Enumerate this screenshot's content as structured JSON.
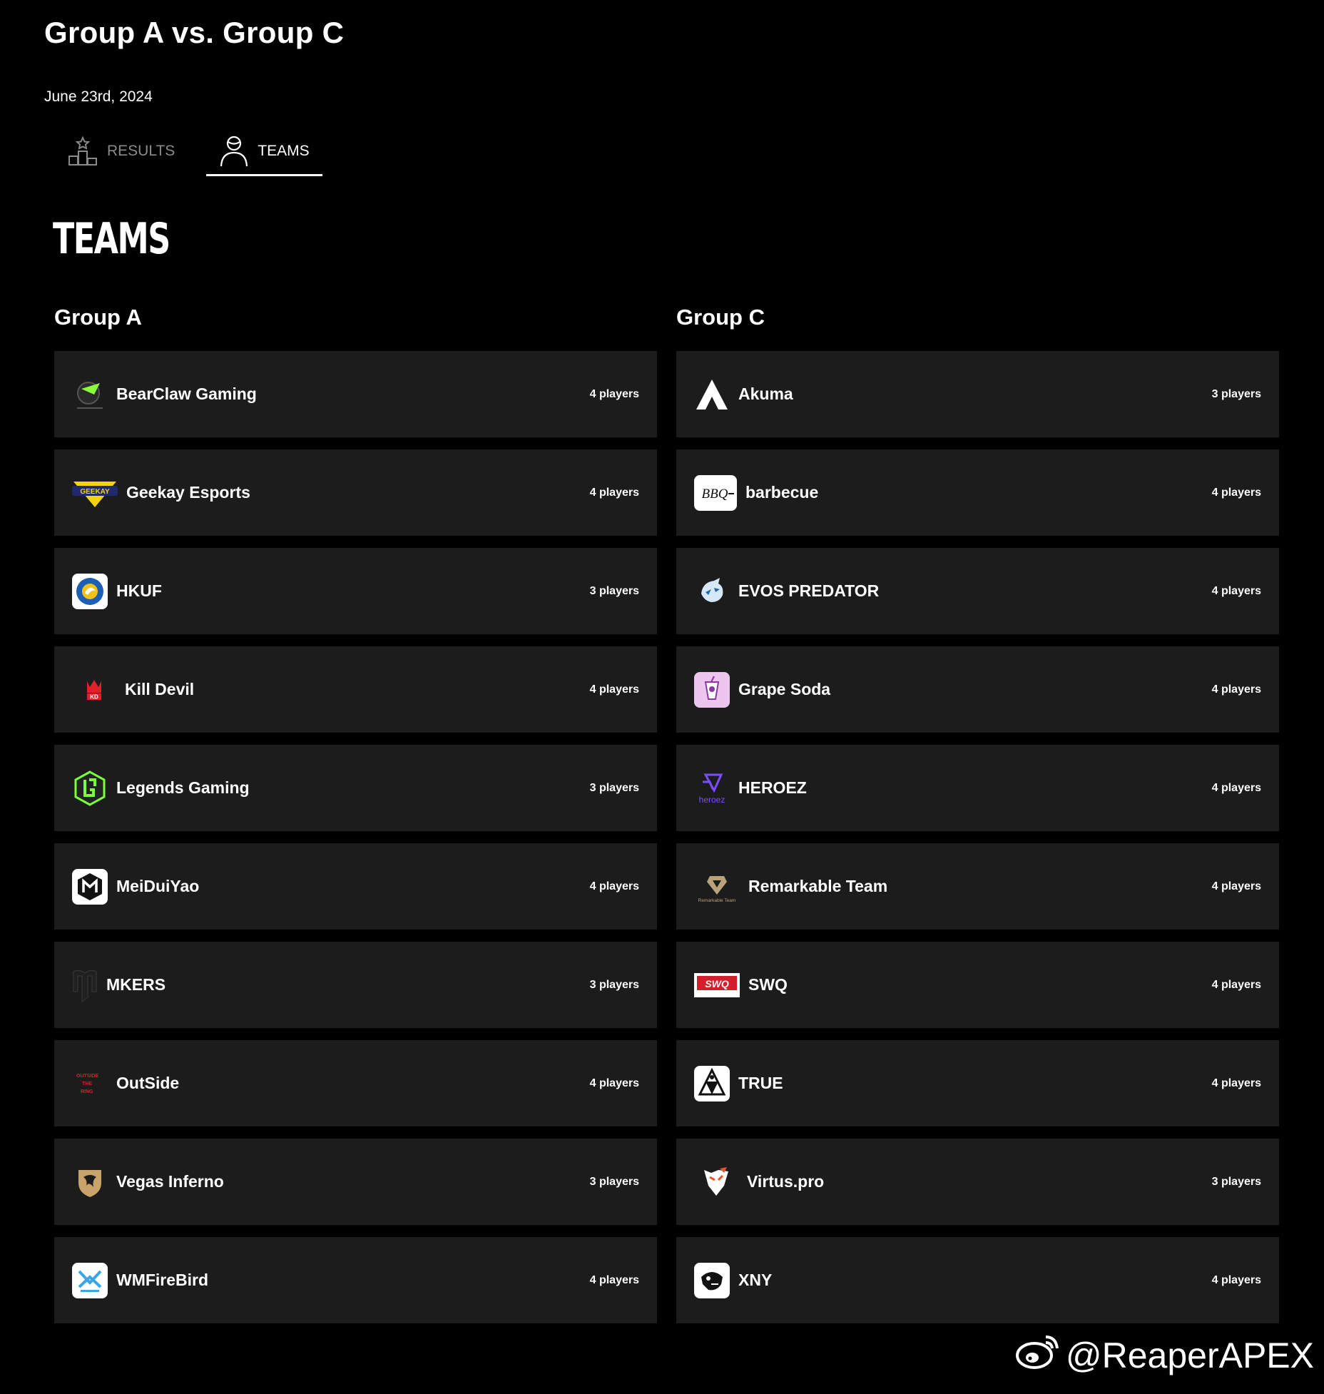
{
  "page": {
    "title": "Group A vs. Group C",
    "date": "June 23rd, 2024"
  },
  "tabs": [
    {
      "label": "RESULTS",
      "icon": "podium-icon"
    },
    {
      "label": "TEAMS",
      "icon": "person-icon"
    }
  ],
  "section_heading": "TEAMS",
  "groups": [
    {
      "title": "Group A",
      "teams": [
        {
          "name": "BearClaw Gaming",
          "players": "4 players",
          "logo": "bearclaw-logo"
        },
        {
          "name": "Geekay Esports",
          "players": "4 players",
          "logo": "geekay-logo",
          "logo_text": "GEEKAY"
        },
        {
          "name": "HKUF",
          "players": "3 players",
          "logo": "hkuf-logo"
        },
        {
          "name": "Kill Devil",
          "players": "4 players",
          "logo": "kill-devil-logo",
          "logo_text": "KD"
        },
        {
          "name": "Legends Gaming",
          "players": "3 players",
          "logo": "legends-gaming-logo"
        },
        {
          "name": "MeiDuiYao",
          "players": "4 players",
          "logo": "meiduiyao-logo"
        },
        {
          "name": "MKERS",
          "players": "3 players",
          "logo": "mkers-logo"
        },
        {
          "name": "OutSide",
          "players": "4 players",
          "logo": "outside-logo",
          "logo_text": "OUTSIDE THE RING"
        },
        {
          "name": "Vegas Inferno",
          "players": "3 players",
          "logo": "vegas-inferno-logo"
        },
        {
          "name": "WMFireBird",
          "players": "4 players",
          "logo": "wmfirebird-logo"
        }
      ]
    },
    {
      "title": "Group C",
      "teams": [
        {
          "name": "Akuma",
          "players": "3 players",
          "logo": "akuma-logo"
        },
        {
          "name": "barbecue",
          "players": "4 players",
          "logo": "barbecue-logo",
          "logo_text": "BBQ"
        },
        {
          "name": "EVOS PREDATOR",
          "players": "4 players",
          "logo": "evos-predator-logo"
        },
        {
          "name": "Grape Soda",
          "players": "4 players",
          "logo": "grape-soda-logo"
        },
        {
          "name": "HEROEZ",
          "players": "4 players",
          "logo": "heroez-logo",
          "logo_text": "heroez"
        },
        {
          "name": "Remarkable Team",
          "players": "4 players",
          "logo": "remarkable-team-logo",
          "logo_text": "Remarkable Team"
        },
        {
          "name": "SWQ",
          "players": "4 players",
          "logo": "swq-logo",
          "logo_text": "SWQ"
        },
        {
          "name": "TRUE",
          "players": "4 players",
          "logo": "true-logo"
        },
        {
          "name": "Virtus.pro",
          "players": "3 players",
          "logo": "virtus-pro-logo"
        },
        {
          "name": "XNY",
          "players": "4 players",
          "logo": "xny-logo"
        }
      ]
    }
  ],
  "watermark": "@ReaperAPEX",
  "colors": {
    "background": "#000000",
    "row": "#1c1c1c",
    "inactive_tab": "#8a8a8a",
    "heroez": "#7a4dff",
    "swq": "#d21f2b",
    "legends": "#7cff3a"
  }
}
